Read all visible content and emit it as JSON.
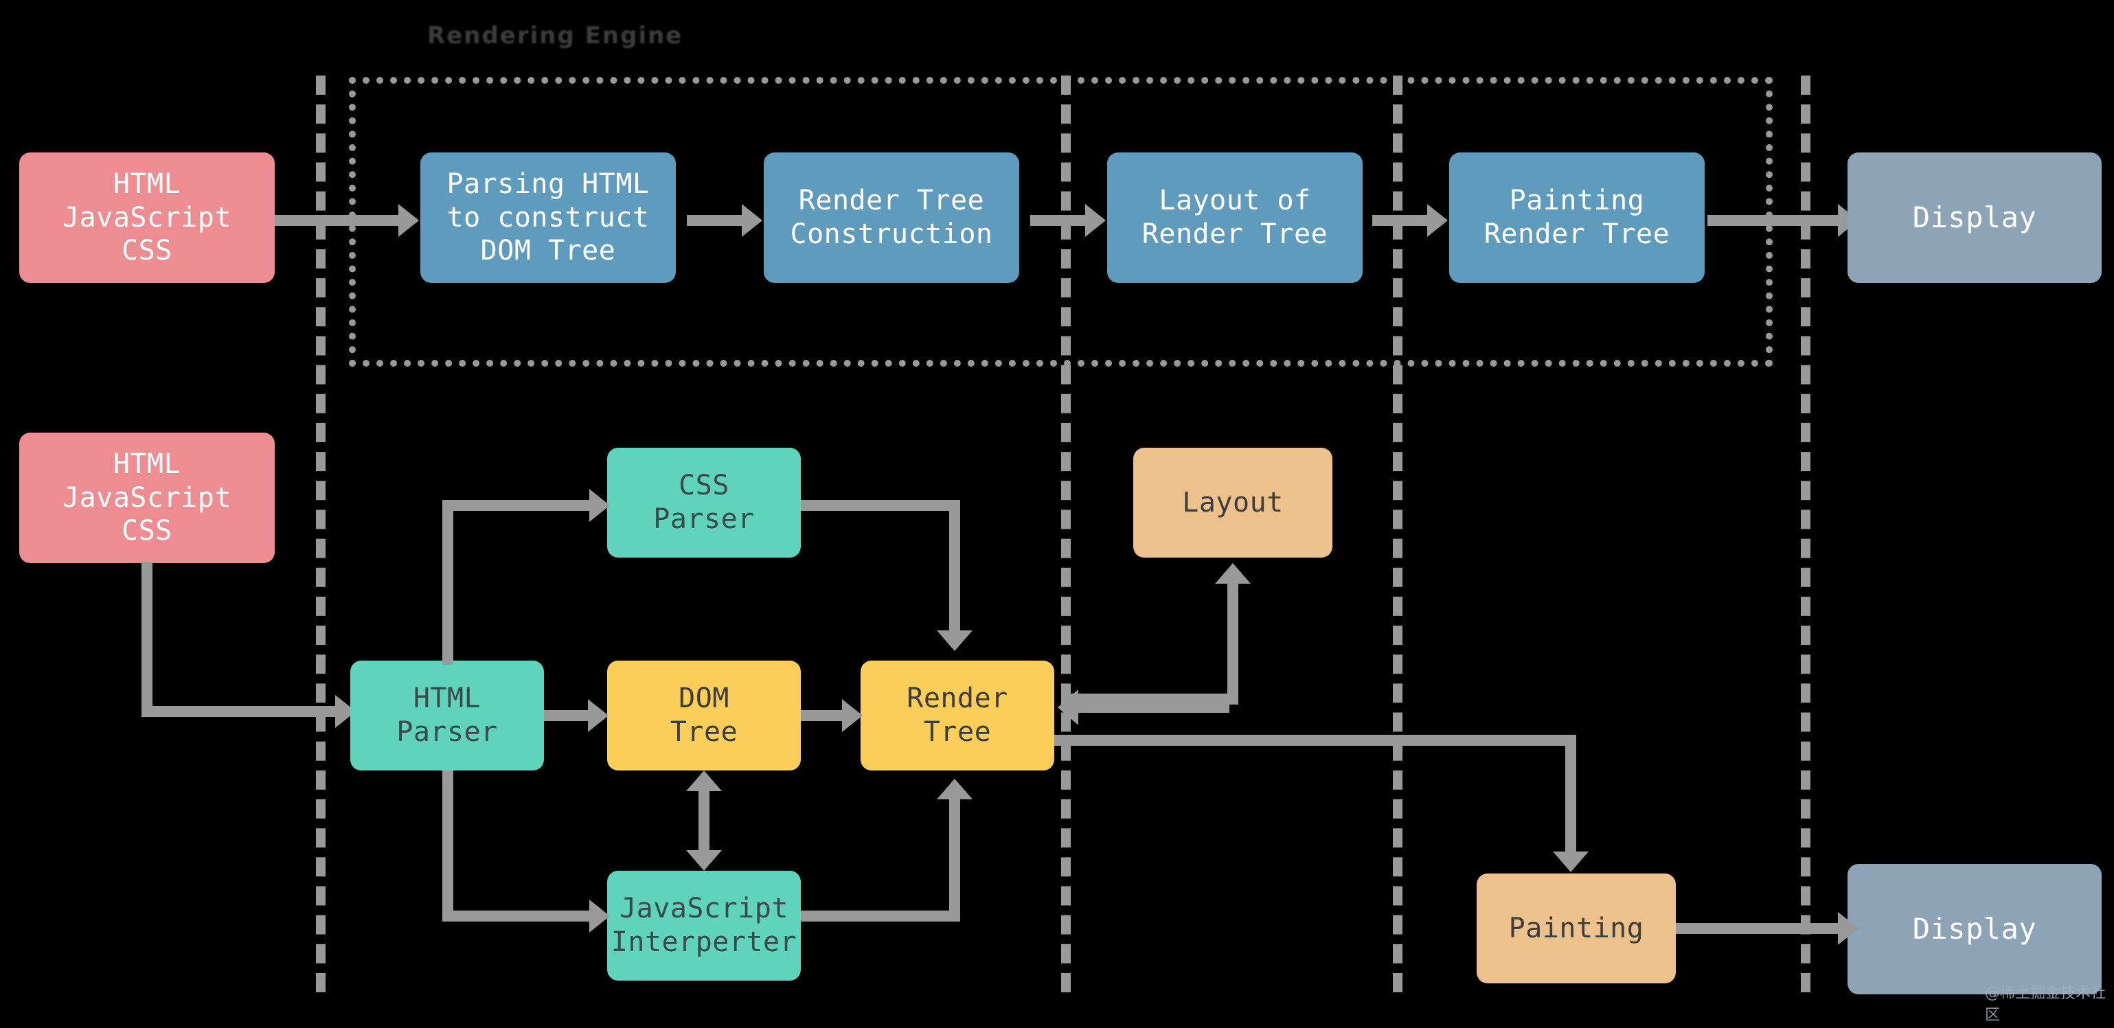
{
  "diagram": {
    "title": "Rendering Engine",
    "watermark": "@稀土掘金技术社区",
    "colors": {
      "background": "#000000",
      "source": "#ee8d91",
      "stage": "#5f9bbd",
      "display": "#8ca4b5",
      "parser": "#5fd3bc",
      "tree": "#fbce5a",
      "render_step": "#edc18b",
      "connector": "#999999"
    }
  },
  "top_flow": {
    "source": "HTML\nJavaScript\nCSS",
    "steps": [
      "Parsing HTML\nto construct\nDOM Tree",
      "Render Tree\nConstruction",
      "Layout of\nRender Tree",
      "Painting\nRender Tree"
    ],
    "output": "Display"
  },
  "bottom_flow": {
    "source": "HTML\nJavaScript\nCSS",
    "nodes": {
      "css_parser": "CSS\nParser",
      "html_parser": "HTML\nParser",
      "dom_tree": "DOM\nTree",
      "render_tree": "Render\nTree",
      "js_interpreter": "JavaScript\nInterperter",
      "layout": "Layout",
      "painting": "Painting",
      "display": "Display"
    }
  },
  "chart_data": {
    "type": "diagram",
    "title": "Rendering Engine",
    "nodes": [
      {
        "id": "src-top",
        "label": "HTML JavaScript CSS",
        "group": "input",
        "color": "#ee8d91"
      },
      {
        "id": "parse",
        "label": "Parsing HTML to construct DOM Tree",
        "group": "pipeline",
        "color": "#5f9bbd"
      },
      {
        "id": "rtc",
        "label": "Render Tree Construction",
        "group": "pipeline",
        "color": "#5f9bbd"
      },
      {
        "id": "lort",
        "label": "Layout of Render Tree",
        "group": "pipeline",
        "color": "#5f9bbd"
      },
      {
        "id": "prt",
        "label": "Painting Render Tree",
        "group": "pipeline",
        "color": "#5f9bbd"
      },
      {
        "id": "disp-top",
        "label": "Display",
        "group": "output",
        "color": "#8ca4b5"
      },
      {
        "id": "src-bot",
        "label": "HTML JavaScript CSS",
        "group": "input",
        "color": "#ee8d91"
      },
      {
        "id": "cssp",
        "label": "CSS Parser",
        "group": "parser",
        "color": "#5fd3bc"
      },
      {
        "id": "htmlp",
        "label": "HTML Parser",
        "group": "parser",
        "color": "#5fd3bc"
      },
      {
        "id": "dom",
        "label": "DOM Tree",
        "group": "tree",
        "color": "#fbce5a"
      },
      {
        "id": "rtree",
        "label": "Render Tree",
        "group": "tree",
        "color": "#fbce5a"
      },
      {
        "id": "jsi",
        "label": "JavaScript Interperter",
        "group": "parser",
        "color": "#5fd3bc"
      },
      {
        "id": "layout",
        "label": "Layout",
        "group": "step",
        "color": "#edc18b"
      },
      {
        "id": "paint",
        "label": "Painting",
        "group": "step",
        "color": "#edc18b"
      },
      {
        "id": "disp-bot",
        "label": "Display",
        "group": "output",
        "color": "#8ca4b5"
      }
    ],
    "edges": [
      {
        "from": "src-top",
        "to": "parse",
        "dir": "->"
      },
      {
        "from": "parse",
        "to": "rtc",
        "dir": "->"
      },
      {
        "from": "rtc",
        "to": "lort",
        "dir": "->"
      },
      {
        "from": "lort",
        "to": "prt",
        "dir": "->"
      },
      {
        "from": "prt",
        "to": "disp-top",
        "dir": "->"
      },
      {
        "from": "src-bot",
        "to": "htmlp",
        "dir": "->"
      },
      {
        "from": "htmlp",
        "to": "cssp",
        "dir": "->"
      },
      {
        "from": "htmlp",
        "to": "dom",
        "dir": "->"
      },
      {
        "from": "htmlp",
        "to": "jsi",
        "dir": "->"
      },
      {
        "from": "cssp",
        "to": "rtree",
        "dir": "->"
      },
      {
        "from": "dom",
        "to": "rtree",
        "dir": "->"
      },
      {
        "from": "dom",
        "to": "jsi",
        "dir": "<->"
      },
      {
        "from": "jsi",
        "to": "rtree",
        "dir": "->"
      },
      {
        "from": "rtree",
        "to": "layout",
        "dir": "->"
      },
      {
        "from": "layout",
        "to": "rtree",
        "dir": "->"
      },
      {
        "from": "rtree",
        "to": "paint",
        "dir": "->"
      },
      {
        "from": "paint",
        "to": "disp-bot",
        "dir": "->"
      }
    ],
    "annotations": [
      "Rendering Engine"
    ]
  }
}
